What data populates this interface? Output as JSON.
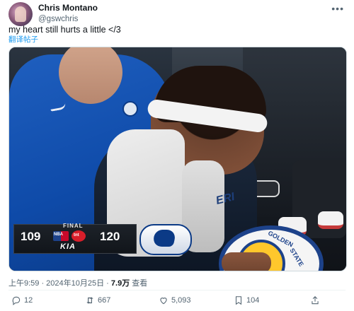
{
  "tweet": {
    "author_name": "Chris Montano",
    "author_handle": "@gswchris",
    "text": "my heart still hurts a little </3",
    "translate_label": "翻译帖子",
    "timestamp": "上午9:59 · 2024年10月25日 · ",
    "views": "7.9万",
    "views_label": " 查看"
  },
  "scoreboard": {
    "status": "FINAL",
    "away_score": "109",
    "home_score": "120",
    "network": "tnt",
    "league": "NBA",
    "sponsor": "KIA"
  },
  "jersey": {
    "chest_text": "ERI"
  },
  "ball": {
    "text_top": "GOLDEN",
    "text_side": "STATE"
  },
  "actions": {
    "replies": "12",
    "reposts": "667",
    "likes": "5,093",
    "bookmarks": "104"
  },
  "icons": {
    "more": "more-icon",
    "reply": "reply-icon",
    "repost": "repost-icon",
    "like": "heart-icon",
    "bookmark": "bookmark-icon",
    "share": "share-icon"
  },
  "colors": {
    "accent": "#1d9bf0",
    "muted": "#536471",
    "text": "#0f1419"
  }
}
